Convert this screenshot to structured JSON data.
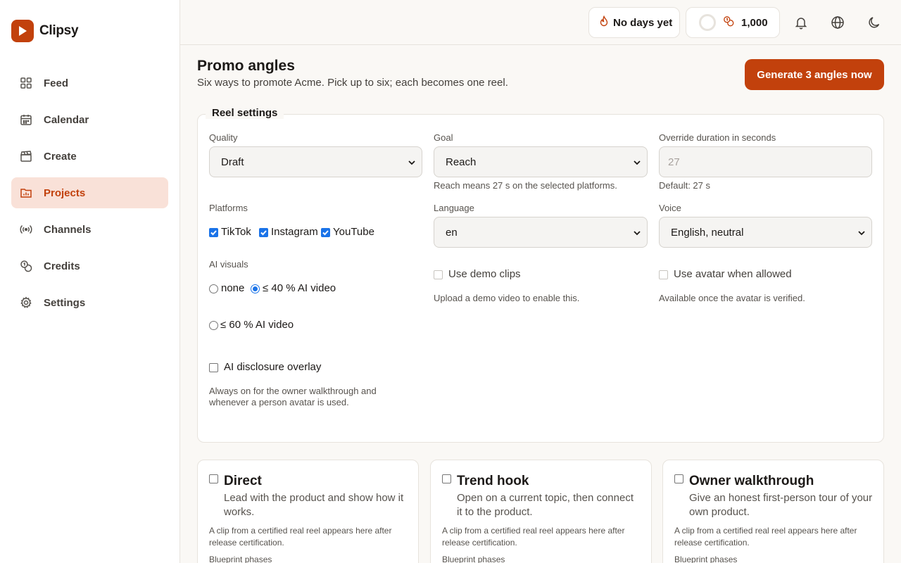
{
  "app": {
    "name": "Clipsy"
  },
  "nav": [
    {
      "label": "Feed",
      "icon": "grid-icon"
    },
    {
      "label": "Calendar",
      "icon": "calendar-icon"
    },
    {
      "label": "Create",
      "icon": "clapperboard-icon"
    },
    {
      "label": "Projects",
      "icon": "folder-chart-icon",
      "active": true
    },
    {
      "label": "Channels",
      "icon": "broadcast-icon"
    },
    {
      "label": "Credits",
      "icon": "coins-icon"
    },
    {
      "label": "Settings",
      "icon": "gear-icon"
    }
  ],
  "topbar": {
    "streak_label": "No days yet",
    "credits_value": "1,000"
  },
  "header": {
    "title": "Promo angles",
    "subtitle": "Six ways to promote Acme. Pick up to six; each becomes one reel.",
    "generate_label": "Generate 3 angles now"
  },
  "settings": {
    "legend": "Reel settings",
    "quality": {
      "label": "Quality",
      "value": "Draft"
    },
    "goal": {
      "label": "Goal",
      "value": "Reach",
      "help": "Reach means 27 s on the selected platforms."
    },
    "duration": {
      "label": "Override duration in seconds",
      "placeholder": "27",
      "help": "Default: 27 s"
    },
    "platforms": {
      "label": "Platforms",
      "options": [
        "TikTok",
        "Instagram",
        "YouTube"
      ]
    },
    "language": {
      "label": "Language",
      "value": "en"
    },
    "voice": {
      "label": "Voice",
      "value": "English, neutral"
    },
    "ai_visuals": {
      "label": "AI visuals",
      "options": [
        "none",
        "≤ 40 % AI video",
        "≤ 60 % AI video"
      ],
      "selected": "≤ 40 % AI video"
    },
    "demo_clips": {
      "label": "Use demo clips",
      "help": "Upload a demo video to enable this."
    },
    "avatar": {
      "label": "Use avatar when allowed",
      "help": "Available once the avatar is verified."
    },
    "disclosure": {
      "label": "AI disclosure overlay",
      "help": "Always on for the owner walkthrough and whenever a person avatar is used."
    }
  },
  "angles": [
    {
      "title": "Direct",
      "desc": "Lead with the product and show how it works.",
      "note": "A clip from a certified real reel appears here after release certification.",
      "phase": "Blueprint phases"
    },
    {
      "title": "Trend hook",
      "desc": "Open on a current topic, then connect it to the product.",
      "note": "A clip from a certified real reel appears here after release certification.",
      "phase": "Blueprint phases"
    },
    {
      "title": "Owner walkthrough",
      "desc": "Give an honest first-person tour of your own product.",
      "note": "A clip from a certified real reel appears here after release certification.",
      "phase": "Blueprint phases"
    }
  ],
  "colors": {
    "accent": "#c2410c",
    "active_bg": "#f9e1d8",
    "checkbox": "#1a73e8"
  }
}
